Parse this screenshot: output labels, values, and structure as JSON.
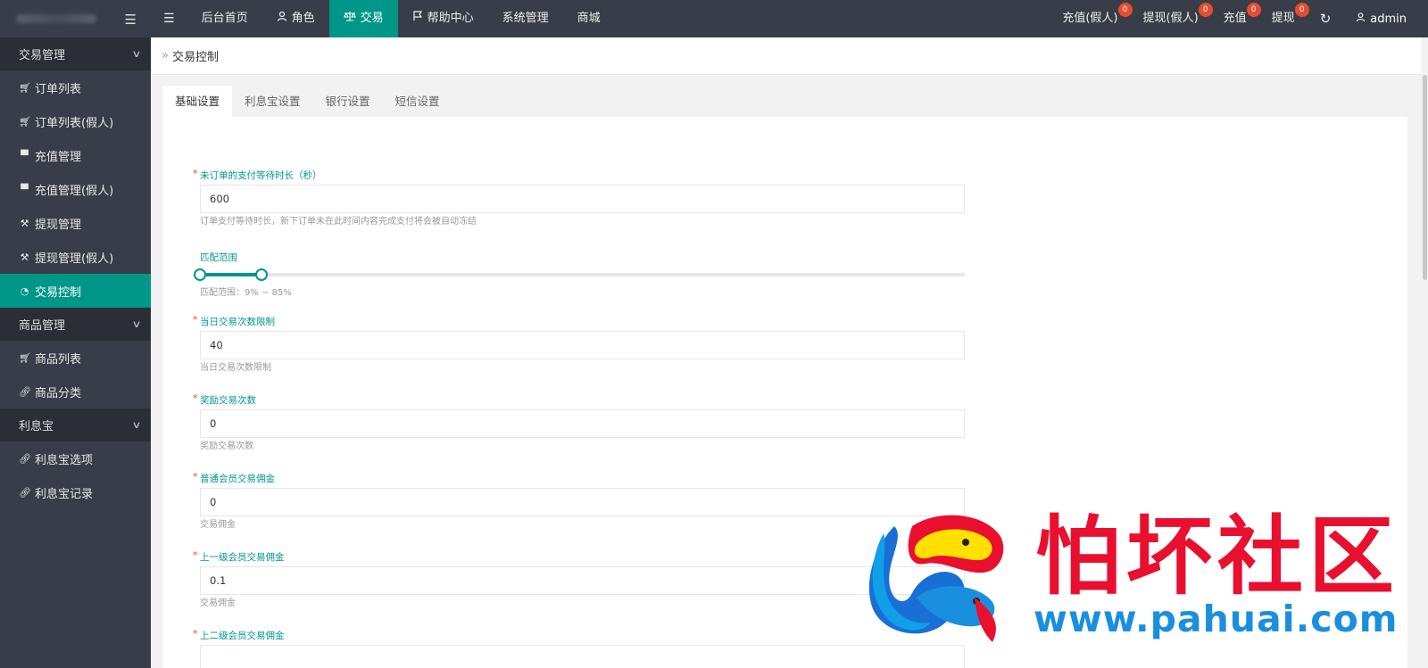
{
  "topnav": {
    "items": [
      {
        "label": "后台首页",
        "icon": ""
      },
      {
        "label": "角色",
        "icon": "user-icon"
      },
      {
        "label": "交易",
        "icon": "balance-icon"
      },
      {
        "label": "帮助中心",
        "icon": "flag-icon"
      },
      {
        "label": "系统管理",
        "icon": ""
      },
      {
        "label": "商城",
        "icon": ""
      }
    ],
    "active_index": 2,
    "right": [
      {
        "label": "充值(假人)",
        "badge": "0"
      },
      {
        "label": "提现(假人)",
        "badge": "0"
      },
      {
        "label": "充值",
        "badge": "0"
      },
      {
        "label": "提现",
        "badge": "0"
      }
    ],
    "user": "admin"
  },
  "sidebar": {
    "group1": "交易管理",
    "items1": [
      {
        "label": "订单列表",
        "icon": "cart-icon"
      },
      {
        "label": "订单列表(假人)",
        "icon": "cart-icon"
      },
      {
        "label": "充值管理",
        "icon": "message-icon"
      },
      {
        "label": "充值管理(假人)",
        "icon": "message-icon"
      },
      {
        "label": "提现管理",
        "icon": "hammer-icon"
      },
      {
        "label": "提现管理(假人)",
        "icon": "hammer-icon"
      },
      {
        "label": "交易控制",
        "icon": "gauge-icon"
      }
    ],
    "group2": "商品管理",
    "items2": [
      {
        "label": "商品列表",
        "icon": "cart-icon"
      },
      {
        "label": "商品分类",
        "icon": "link-icon"
      }
    ],
    "group3": "利息宝",
    "items3": [
      {
        "label": "利息宝选项",
        "icon": "link-icon"
      },
      {
        "label": "利息宝记录",
        "icon": "link-icon"
      }
    ]
  },
  "breadcrumb": "交易控制",
  "tabs": [
    "基础设置",
    "利息宝设置",
    "银行设置",
    "短信设置"
  ],
  "form": {
    "f1": {
      "label": "未订单的支付等待时长（秒）",
      "value": "600",
      "hint": "订单支付等待时长，新下订单未在此时间内容完成支付将会被自动冻结"
    },
    "range": {
      "label": "匹配范围",
      "hint": "匹配范围：9% ~ 85%",
      "low": 0,
      "high": 0.08
    },
    "f2": {
      "label": "当日交易次数限制",
      "value": "40",
      "hint": "当日交易次数限制"
    },
    "f3": {
      "label": "奖励交易次数",
      "value": "0",
      "hint": "奖励交易次数"
    },
    "f4": {
      "label": "普通会员交易佣金",
      "value": "0",
      "hint": "交易佣金"
    },
    "f5": {
      "label": "上一级会员交易佣金",
      "value": "0.1",
      "hint": "交易佣金"
    },
    "f6": {
      "label": "上二级会员交易佣金",
      "value": ""
    }
  },
  "watermark": {
    "cn": "怕坏社区",
    "url": "www.pahuai.com"
  },
  "colors": {
    "accent": "#009688",
    "topbar": "#393d49",
    "badge": "#e64d2e"
  }
}
